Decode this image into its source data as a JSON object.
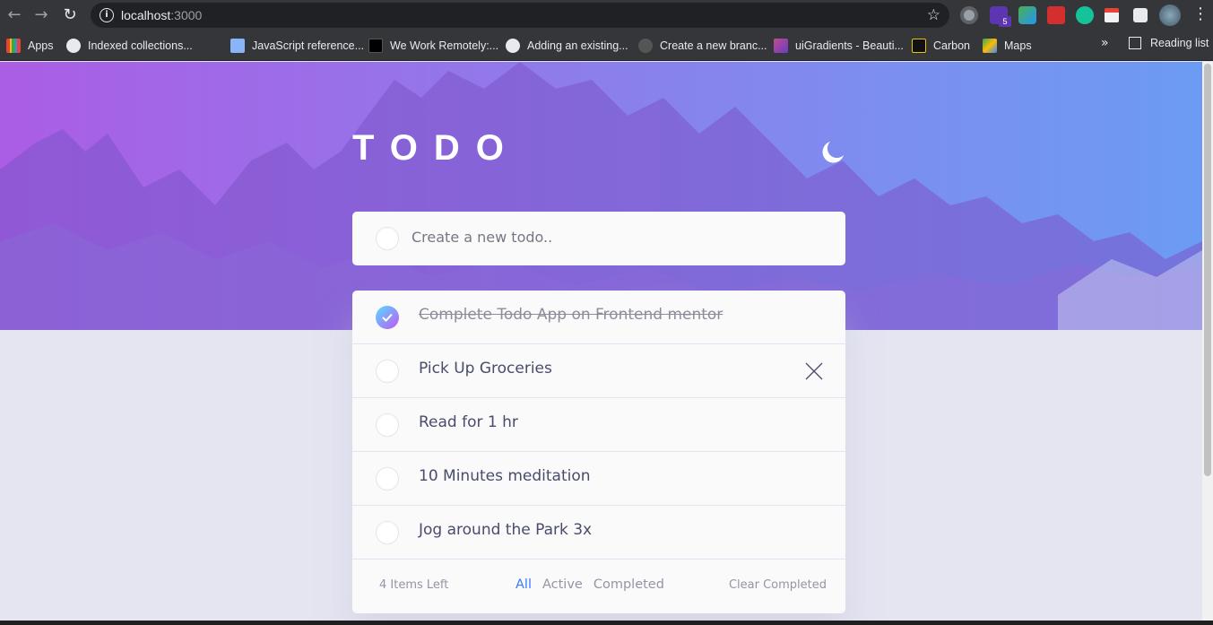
{
  "browser": {
    "url_host": "localhost",
    "url_port": ":3000",
    "extension_badge": "5",
    "bookmarks": [
      {
        "label": "Apps",
        "color": "#ea4335"
      },
      {
        "label": "Indexed collections...",
        "color": "#ffffff"
      },
      {
        "label": "JavaScript reference...",
        "color": "#8ab4f8"
      },
      {
        "label": "We Work Remotely:...",
        "color": "#000000"
      },
      {
        "label": "Adding an existing...",
        "color": "#ffffff"
      },
      {
        "label": "Create a new branc...",
        "color": "#555555"
      },
      {
        "label": "uiGradients - Beauti...",
        "color": "#c04c8f"
      },
      {
        "label": "Carbon",
        "color": "#e8c21a"
      },
      {
        "label": "Maps",
        "color": "#34a853"
      }
    ],
    "reading_list": "Reading list"
  },
  "app": {
    "title": "TODO",
    "theme_icon": "moon-icon",
    "new_todo_placeholder": "Create a new todo..",
    "todos": [
      {
        "text": "Complete Todo App on Frontend mentor",
        "completed": true
      },
      {
        "text": "Pick Up Groceries",
        "completed": false
      },
      {
        "text": "Read for 1 hr",
        "completed": false
      },
      {
        "text": "10 Minutes meditation",
        "completed": false
      },
      {
        "text": "Jog around the Park 3x",
        "completed": false
      }
    ],
    "footer": {
      "items_left": "4 Items Left",
      "filter_all": "All",
      "filter_active": "Active",
      "filter_completed": "Completed",
      "clear_completed": "Clear Completed"
    }
  },
  "colors": {
    "accent": "#3a7cfd",
    "hero_start": "#ab5de5",
    "hero_end": "#6c9bf3",
    "check_start": "#55ddff",
    "check_end": "#c058f3"
  }
}
